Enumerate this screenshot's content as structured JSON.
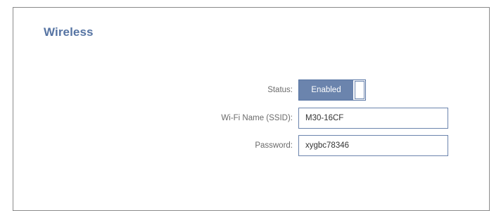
{
  "section": {
    "title": "Wireless"
  },
  "form": {
    "status": {
      "label": "Status:",
      "value": "Enabled"
    },
    "ssid": {
      "label": "Wi-Fi Name (SSID):",
      "value": "M30-16CF"
    },
    "password": {
      "label": "Password:",
      "value": "xygbc78346"
    }
  },
  "colors": {
    "accent": "#5674a3",
    "toggle_fill": "#6b84ad",
    "label_text": "#6b6b6b",
    "border": "#8a8a8a"
  }
}
